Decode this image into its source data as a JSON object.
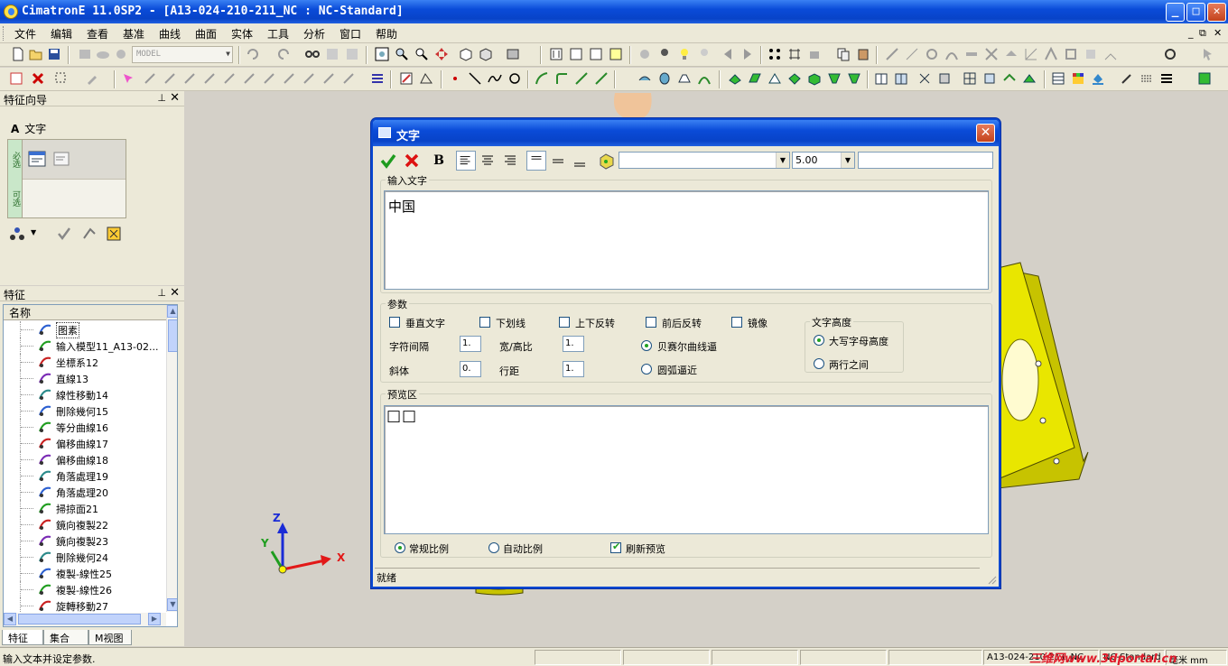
{
  "window": {
    "title": "CimatronE 11.0SP2 - [A13-024-210-211_NC : NC-Standard]",
    "controls": {
      "minimize": "_",
      "maximize": "□",
      "close": "✕"
    }
  },
  "menubar": {
    "items": [
      "文件",
      "编辑",
      "查看",
      "基准",
      "曲线",
      "曲面",
      "实体",
      "工具",
      "分析",
      "窗口",
      "帮助"
    ],
    "mdi_controls": [
      "_",
      "⧉",
      "✕"
    ]
  },
  "toolbar": {
    "model_combo": "MODEL"
  },
  "feature_guide_panel": {
    "title": "特征向导",
    "item_label": "文字",
    "item_glyph": "A",
    "tab_required": "必选",
    "tab_optional": "可选"
  },
  "feature_panel": {
    "title": "特征",
    "column_header": "名称",
    "items": [
      {
        "label": "图素",
        "icon": "entity-icon"
      },
      {
        "label": "输入模型11_A13-02...",
        "icon": "import-model-icon"
      },
      {
        "label": "坐標系12",
        "icon": "ucs-icon"
      },
      {
        "label": "直線13",
        "icon": "line-icon"
      },
      {
        "label": "線性移動14",
        "icon": "linear-move-icon"
      },
      {
        "label": "刪除幾何15",
        "icon": "delete-geometry-icon"
      },
      {
        "label": "等分曲線16",
        "icon": "divide-curve-icon"
      },
      {
        "label": "偏移曲線17",
        "icon": "offset-curve-icon"
      },
      {
        "label": "偏移曲線18",
        "icon": "offset-curve-icon"
      },
      {
        "label": "角落處理19",
        "icon": "corner-icon"
      },
      {
        "label": "角落處理20",
        "icon": "corner-icon"
      },
      {
        "label": "掃掠面21",
        "icon": "sweep-icon"
      },
      {
        "label": "鏡向複製22",
        "icon": "mirror-icon"
      },
      {
        "label": "鏡向複製23",
        "icon": "mirror-icon"
      },
      {
        "label": "刪除幾何24",
        "icon": "delete-geometry-icon"
      },
      {
        "label": "複製-線性25",
        "icon": "copy-linear-icon"
      },
      {
        "label": "複製-線性26",
        "icon": "copy-linear-icon"
      },
      {
        "label": "旋轉移動27",
        "icon": "rotate-icon"
      }
    ]
  },
  "bottom_tabs": [
    "特征",
    "集合",
    "M视图"
  ],
  "statusbar": {
    "message": "输入文本并设定参数.",
    "right_text": "A13-024-210-211_NC",
    "right_text2": "NC-Standard",
    "right_text3": "毫米 mm",
    "watermark": "三维网www.3dportal.cn"
  },
  "viewport": {
    "axis_x": "X",
    "axis_y": "Y",
    "axis_z": "Z"
  },
  "dialog": {
    "title": "文字",
    "font_combo": "",
    "size_combo": "5.00",
    "extra_field": "",
    "bold_label": "B",
    "input_group_label": "输入文字",
    "input_text": "中国",
    "params_group_label": "参数",
    "checkboxes": {
      "vertical": "垂直文字",
      "underline": "下划线",
      "flip_vertical": "上下反转",
      "flip_horizontal": "前后反转",
      "mirror": "镜像"
    },
    "char_spacing_label": "字符间隔",
    "char_spacing_value": "1.",
    "width_height_label": "宽/高比",
    "width_height_value": "1.",
    "slant_label": "斜体",
    "slant_value": "0.",
    "line_spacing_label": "行距",
    "line_spacing_value": "1.",
    "approx_bezier": "贝赛尔曲线逼",
    "approx_arc": "圆弧逼近",
    "text_height_group": "文字高度",
    "height_upper": "大写字母高度",
    "height_between": "两行之间",
    "preview_group_label": "预览区",
    "preview_glyphs": "□□",
    "scale_normal": "常规比例",
    "scale_auto": "自动比例",
    "refresh_preview": "刷新预览",
    "status": "就绪"
  }
}
